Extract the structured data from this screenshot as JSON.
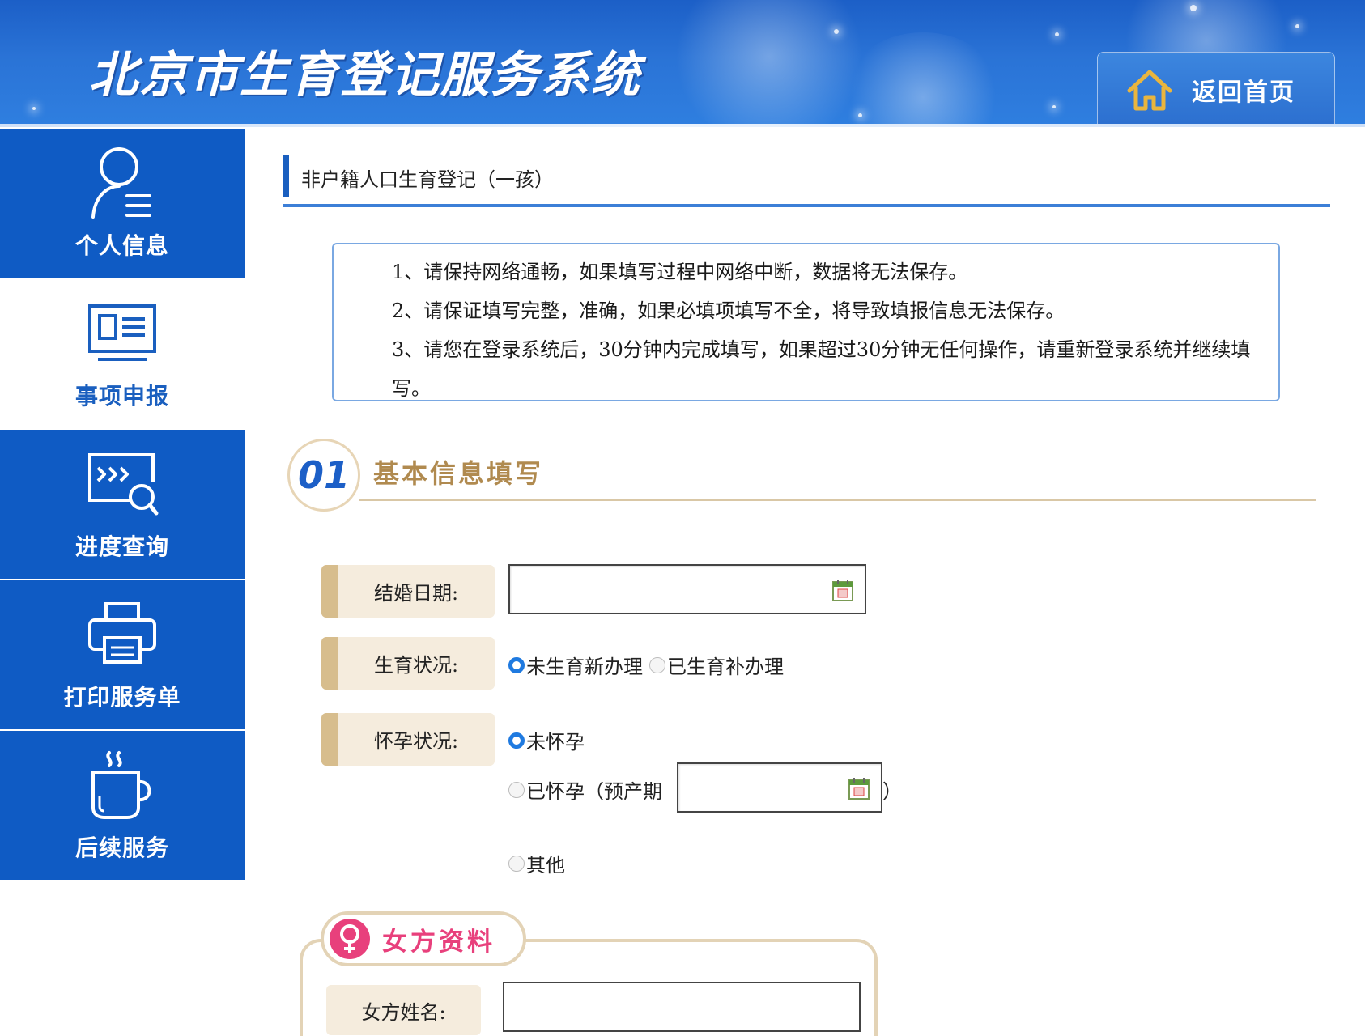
{
  "header": {
    "site_title": "北京市生育登记服务系统",
    "home_label": "返回首页"
  },
  "sidebar": {
    "items": [
      {
        "label": "个人信息",
        "icon": "person-list-icon",
        "active": false
      },
      {
        "label": "事项申报",
        "icon": "document-card-icon",
        "active": true
      },
      {
        "label": "进度查询",
        "icon": "progress-search-icon",
        "active": false
      },
      {
        "label": "打印服务单",
        "icon": "printer-icon",
        "active": false
      },
      {
        "label": "后续服务",
        "icon": "coffee-cup-icon",
        "active": false
      }
    ]
  },
  "panel": {
    "title": "非户籍人口生育登记（一孩）",
    "notices": [
      "1、请保持网络通畅，如果填写过程中网络中断，数据将无法保存。",
      "2、请保证填写完整，准确，如果必填项填写不全，将导致填报信息无法保存。",
      "3、请您在登录系统后，30分钟内完成填写，如果超过30分钟无任何操作，请重新登录系统并继续填写。"
    ]
  },
  "section_basic": {
    "number": "01",
    "title": "基本信息填写",
    "marriage_date": {
      "label": "结婚日期:",
      "value": ""
    },
    "birth_status": {
      "label": "生育状况:",
      "options": [
        "未生育新办理",
        "已生育补办理"
      ],
      "selected": "未生育新办理"
    },
    "pregnancy_status": {
      "label": "怀孕状况:",
      "option_not_pregnant": "未怀孕",
      "option_pregnant_prefix": "已怀孕（预产期",
      "option_pregnant_suffix": "）",
      "option_other": "其他",
      "selected": "未怀孕",
      "due_date_value": ""
    }
  },
  "section_female": {
    "title": "女方资料",
    "name_label": "女方姓名:",
    "name_value": ""
  },
  "colors": {
    "primary_blue": "#0f5bc4",
    "gold": "#b08a4f",
    "female_pink": "#e8407c"
  }
}
